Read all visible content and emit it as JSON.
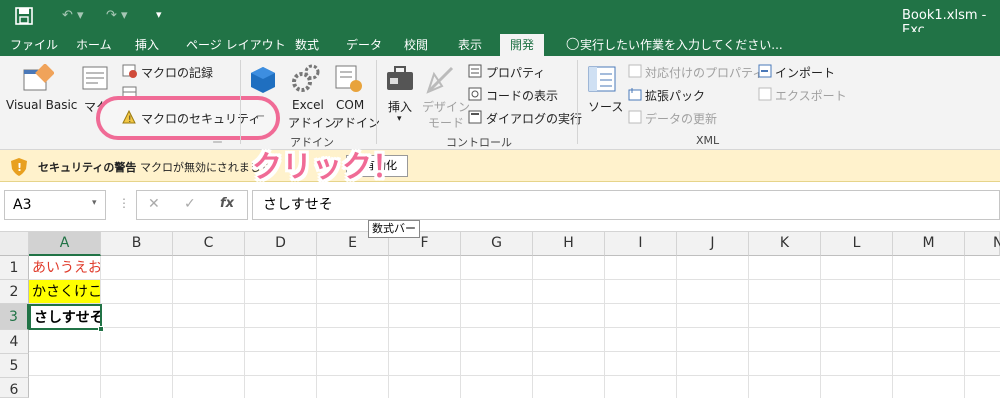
{
  "title_bar": {
    "file_name": "Book1.xlsm - Exc"
  },
  "tabs": [
    "ファイル",
    "ホーム",
    "挿入",
    "ページ レイアウト",
    "数式",
    "データ",
    "校閲",
    "表示",
    "開発"
  ],
  "tell_me": "実行したい作業を入力してください...",
  "ribbon": {
    "code": {
      "visual_basic": "Visual Basic",
      "macro": "マク",
      "record_macro": "マクロの記録",
      "macro_security": "マクロのセキュリティ"
    },
    "addins": {
      "excel_addin_1": "Excel",
      "excel_addin_2": "アドイン",
      "com_addin_1": "COM",
      "com_addin_2": "アドイン",
      "group": "アドイン"
    },
    "controls": {
      "insert": "挿入",
      "design_1": "デザイン",
      "design_2": "モード",
      "properties": "プロパティ",
      "view_code": "コードの表示",
      "run_dialog": "ダイアログの実行",
      "group": "コントロール"
    },
    "xml": {
      "source": "ソース",
      "map_props": "対応付けのプロパティ",
      "expansion_packs": "拡張パック",
      "refresh": "データの更新",
      "import": "インポート",
      "export": "エクスポート",
      "group": "XML"
    }
  },
  "message_bar": {
    "title": "セキュリティの警告",
    "text": "マクロが無効にされました。",
    "button": "有効化"
  },
  "annotation": "クリック！",
  "formula_bar": {
    "name_box": "A3",
    "value": "さしすせそ",
    "tooltip": "数式バー"
  },
  "columns": [
    "A",
    "B",
    "C",
    "D",
    "E",
    "F",
    "G",
    "H",
    "I",
    "J",
    "K",
    "L",
    "M",
    "N"
  ],
  "rows": [
    "1",
    "2",
    "3",
    "4",
    "5",
    "6"
  ],
  "cells": {
    "a1": "あいうえお",
    "a2": "かさくけこ",
    "a3": "さしすせそ"
  },
  "colors": {
    "excel_green": "#217346",
    "warning_bg": "#fff2cc",
    "callout_pink": "#f06b96",
    "a1_text": "#e03c2c",
    "a2_fill": "#ffff00"
  }
}
